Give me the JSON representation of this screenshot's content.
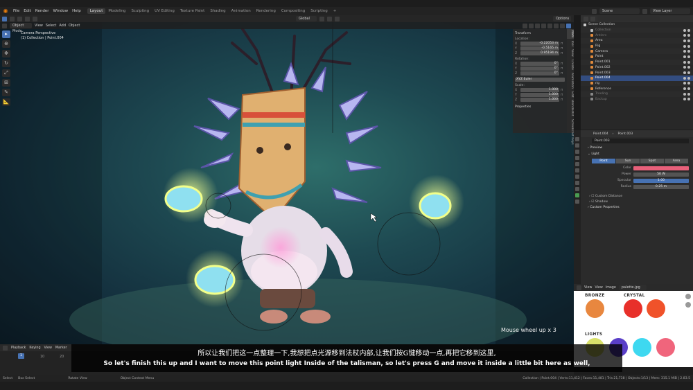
{
  "topbar": {
    "menus": [
      "File",
      "Edit",
      "Render",
      "Window",
      "Help"
    ],
    "workspaces": [
      "Layout",
      "Modeling",
      "Sculpting",
      "UV Editing",
      "Texture Paint",
      "Shading",
      "Animation",
      "Rendering",
      "Compositing",
      "Scripting"
    ],
    "active_workspace": "Layout",
    "scene": "Scene",
    "view_layer": "View Layer"
  },
  "tool_header": {
    "orientation": "Global",
    "options": "Options"
  },
  "viewport_header": {
    "mode": "Object Mode",
    "menus": [
      "View",
      "Select",
      "Add",
      "Object"
    ]
  },
  "viewport": {
    "perspective": "Camera Perspective",
    "collection": "(1) Collection | Point.004",
    "mouse_hint": "Mouse wheel up x 3"
  },
  "npanel": {
    "transform_title": "Transform",
    "location_label": "Location:",
    "location": [
      {
        "axis": "X",
        "value": "-0.22053 m"
      },
      {
        "axis": "Y",
        "value": "-0.5165 m"
      },
      {
        "axis": "Z",
        "value": "0.95194 m"
      }
    ],
    "rotation_label": "Rotation:",
    "rotation": [
      {
        "axis": "X",
        "value": "0°"
      },
      {
        "axis": "Y",
        "value": "0°"
      },
      {
        "axis": "Z",
        "value": "0°"
      }
    ],
    "rotation_mode": "XYZ Euler",
    "scale_label": "Scale:",
    "scale": [
      {
        "axis": "X",
        "value": "1.000"
      },
      {
        "axis": "Y",
        "value": "1.000"
      },
      {
        "axis": "Z",
        "value": "1.000"
      }
    ],
    "properties_title": "Properties",
    "tabs": [
      "Item",
      "Tool",
      "View",
      "Create",
      "Animation",
      "Edit",
      "BlenderKit",
      "Screencast Keys"
    ]
  },
  "outliner": {
    "title": "Scene Collection",
    "rows": [
      {
        "label": "Collection",
        "dim": true,
        "selected": false,
        "color": "#bbbbbb"
      },
      {
        "label": "Antlers",
        "dim": true,
        "selected": false,
        "color": "#e08a3c"
      },
      {
        "label": "Area",
        "dim": false,
        "selected": false,
        "color": "#e08a3c"
      },
      {
        "label": "Rig",
        "dim": false,
        "selected": false,
        "color": "#e08a3c"
      },
      {
        "label": "Camera",
        "dim": false,
        "selected": false,
        "color": "#e08a3c"
      },
      {
        "label": "Point",
        "dim": false,
        "selected": false,
        "color": "#e08a3c"
      },
      {
        "label": "Point.001",
        "dim": false,
        "selected": false,
        "color": "#e08a3c"
      },
      {
        "label": "Point.002",
        "dim": false,
        "selected": false,
        "color": "#e08a3c"
      },
      {
        "label": "Point.003",
        "dim": false,
        "selected": false,
        "color": "#e08a3c"
      },
      {
        "label": "Point.004",
        "dim": false,
        "selected": true,
        "color": "#e08a3c"
      },
      {
        "label": "rig",
        "dim": false,
        "selected": false,
        "color": "#e08a3c"
      },
      {
        "label": "Reference",
        "dim": false,
        "selected": false,
        "color": "#e08a3c"
      },
      {
        "label": "Treeling",
        "dim": true,
        "selected": false,
        "color": "#888888"
      },
      {
        "label": "Backup",
        "dim": true,
        "selected": false,
        "color": "#888888"
      }
    ]
  },
  "properties": {
    "object_name": "Point.004",
    "data_name": "Point.003",
    "data_field": "Point.003",
    "preview": "Preview",
    "light": "Light",
    "light_types": [
      "Point",
      "Sun",
      "Spot",
      "Area"
    ],
    "active_light_type": "Point",
    "color_label": "Color",
    "color_value": "#e8607a",
    "power_label": "Power",
    "power_value": "50 W",
    "specular_label": "Specular",
    "specular_value": "1.00",
    "radius_label": "Radius",
    "radius_value": "0.25 m",
    "custom_distance": "Custom Distance",
    "shadow": "Shadow",
    "custom_properties": "Custom Properties"
  },
  "image_editor": {
    "menus": [
      "View",
      "View",
      "Image"
    ],
    "image_name": "palette.jpg",
    "groups": [
      {
        "title": "BRONZE",
        "colors": [
          "#e8873f"
        ]
      },
      {
        "title": "CRYSTAL",
        "colors": [
          "#e8302a",
          "#f0522a"
        ]
      },
      {
        "title": "LIGHTS",
        "colors": [
          "#d8e06a",
          "#5a3fc8",
          "#3ed8f0",
          "#f0657c"
        ]
      }
    ]
  },
  "timeline": {
    "menus": [
      "Playback",
      "Keying",
      "View",
      "Marker"
    ],
    "current_frame": "1",
    "ruler": [
      "1",
      "10",
      "20"
    ]
  },
  "statusbar": {
    "items": [
      "Select",
      "Box Select",
      "Rotate View",
      "Object Context Menu"
    ],
    "stats": "Collection | Point.004 | Verts:11,412 | Faces:11,481 | Tris:21,738 | Objects:1/13 | Mem: 315.1 MiB | 2.83.5"
  },
  "subtitles": {
    "chinese": "所以让我们把这一点整理一下,我想把点光源移到法杖内部,让我们按G键移动一点,再把它移到这里,",
    "english": "So let's finish this up and I want to move this point light Inside of the talisman, so let's press G and move it inside a little bit here as well,"
  }
}
